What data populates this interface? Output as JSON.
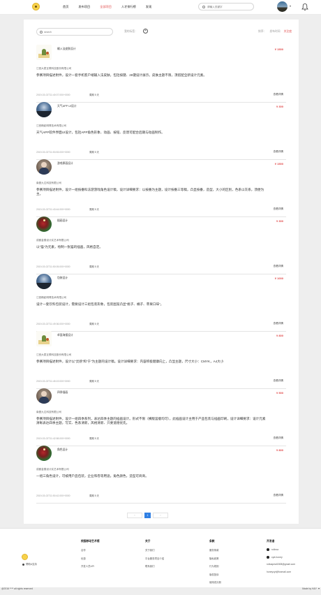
{
  "header": {
    "nav": [
      "首页",
      "发布项目",
      "全部项目",
      "人才排行榜",
      "发现"
    ],
    "active_index": 2,
    "search_placeholder": "请输入关键字"
  },
  "filter": {
    "search_placeholder": "search",
    "my_tags_label": "我的标签：",
    "add_symbol": "+",
    "sort_label": "排序：",
    "sort_options": [
      "发布时间",
      "关注度"
    ]
  },
  "projects": [
    {
      "title": "输入法皮肤设计",
      "price": "¥ 1500",
      "company": "江西大麦互联科技股份有限公司",
      "desc": "参赛项目描述附件，设计一套手机客户端输入法皮肤，包括按键、26键设计展示。皮肤主题不限，须搭配全新设计元素。",
      "time": "2019-03-02T11:40:07.000+0000",
      "cycle": "周期 5 天",
      "detail": "查看详情",
      "thumb": "sketch"
    },
    {
      "title": "天气APP UI设计",
      "price": "¥ 300",
      "company": "江西畅起明哥技术有限公司",
      "desc": "天气APP软件界面UI设计，包括APP角色形象、动画、按钮、反馈可配合后期与动画制作。",
      "time": "2019-03-02T11:53:53.000+0000",
      "cycle": "周期 5 天",
      "detail": "查看详情",
      "thumb": "sky"
    },
    {
      "title": "游戏原画设计",
      "price": "¥ 1500",
      "company": "南昌九达科技有限公司",
      "desc": "参赛项目描述附件，设计一组按番科法游游戏角色设计稿，设计详细要求：以按番为主题，设计按番三等稿，凸显按番，造型，大小的区别，色系以灰系，须便为主。",
      "time": "2019-03-02T11:43:44.000+0000",
      "cycle": "周期 5 天",
      "detail": "查看详情",
      "thumb": "girl"
    },
    {
      "title": "插画设计",
      "price": "¥ 300",
      "company": "成都金猴设计实艺术有限公司",
      "desc": "以“猫”为元素，绘制一张猫的插画，风格自定。",
      "time": "2019-03-02T11:50:05.000+0000",
      "cycle": "周期 5 天",
      "detail": "查看详情",
      "thumb": "art"
    },
    {
      "title": "包装设计",
      "price": "¥ 1000",
      "company": "江西畅起明哥技术有限公司",
      "desc": "设计一套饮料包装设计，需要设计三组包装形象，包装图案凸显“桃子、橘子、苹果口味”。",
      "time": "2019-03-02T11:49:36.000+0000",
      "cycle": "周期 5 天",
      "detail": "查看详情",
      "thumb": "sky"
    },
    {
      "title": "卓面海报设计",
      "price": "¥ 800",
      "company": "江西大麦互联科技股份有限公司",
      "desc": "参赛项目描述附件，设计以“灵感”和“于”为主题的设计稿。设计详细要求：内容积极健康向上，凸显主题，尺寸大小：CMYK，A4大小",
      "time": "2019-03-02T11:45:19.000+0000",
      "cycle": "周期 5 天",
      "detail": "查看详情",
      "thumb": "sketch"
    },
    {
      "title": "四季插画",
      "price": "¥ 500",
      "company": "南昌九达科技有限公司",
      "desc": "参赛项目描述附件，设计一组四季系列，表达四季主题的插画设计。形式不限（横版竖版均可），此插画设计主用于产品包装与插画印刷，设计详细要求：设计元素清晰表达四季主题，写实、色系清新，风格清新、只要道德优先。",
      "time": "2019-03-02T11:42:58.000+0000",
      "cycle": "周期 5 天",
      "detail": "查看详情",
      "thumb": "girl"
    },
    {
      "title": "角色设计",
      "price": "¥ 800",
      "company": "成都金猴设计实艺术有限公司",
      "desc": "一组三角色设计，可被用户品包装，企业和卷等用途。角色颜色，造型可商商。",
      "time": "2019-03-02T11:50:42.000+0000",
      "cycle": "周期 5 天",
      "detail": "查看详情",
      "thumb": "art"
    }
  ],
  "pager": {
    "prev": "‹",
    "current": "1",
    "next": "›"
  },
  "footer": {
    "help": "帮助&支持",
    "columns": [
      {
        "head": "校园移动艺术馆",
        "links": [
          "合作",
          "优惠",
          "开发人员API"
        ]
      },
      {
        "head": "关于",
        "links": [
          "关于我们",
          "平台服务项目介绍",
          "联系我们"
        ]
      },
      {
        "head": "条款",
        "links": [
          "服务条款",
          "隐私政策",
          "行为规则",
          "版权投诉",
          "使用说分册"
        ]
      }
    ],
    "dev": {
      "head": "开发者",
      "github": [
        "rollova",
        "cyd-honey"
      ],
      "emails": [
        "rolloaprial1508@gmail.com",
        "honeyxyt@foxmail.com"
      ]
    },
    "copyright": "@2016 **** all rights reserved",
    "made_by": "Made by H&Y"
  },
  "colors": {
    "accent": "#e14a4a",
    "pager_active": "#2f7fe3",
    "page_bg": "#eeeeee"
  }
}
